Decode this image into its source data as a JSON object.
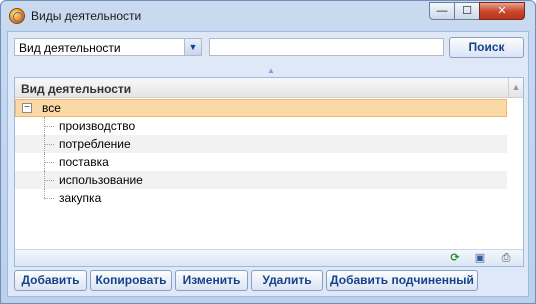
{
  "window": {
    "title": "Виды деятельности",
    "controls": {
      "minimize": "—",
      "maximize": "☐",
      "close": "✕"
    }
  },
  "filter": {
    "field_select_value": "Вид деятельности",
    "search_value": "",
    "search_button": "Поиск"
  },
  "grid": {
    "column_header": "Вид деятельности",
    "root": {
      "label": "все",
      "toggle": "−"
    },
    "children": [
      {
        "label": "производство"
      },
      {
        "label": "потребление"
      },
      {
        "label": "поставка"
      },
      {
        "label": "использование"
      },
      {
        "label": "закупка"
      }
    ]
  },
  "icons": {
    "app": "globe-icon",
    "dropdown": "chevron-down-icon",
    "refresh": "refresh-icon",
    "save": "floppy-disk-icon",
    "print": "printer-icon"
  },
  "toolbar": {
    "add": "Добавить",
    "copy": "Копировать",
    "edit": "Изменить",
    "delete": "Удалить",
    "add_child": "Добавить подчиненный"
  },
  "colors": {
    "selection": "#fbd9a7",
    "accent_text": "#15428b",
    "panel_bg": "#dfe8f6"
  }
}
